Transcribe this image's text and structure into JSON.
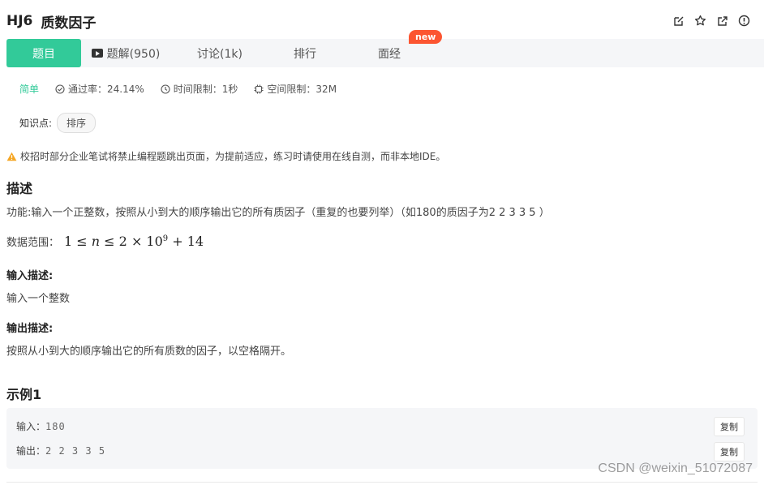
{
  "header": {
    "problem_id": "HJ6",
    "problem_name": "质数因子",
    "actions": [
      "edit-icon",
      "star-icon",
      "external-link-icon",
      "info-icon"
    ]
  },
  "tabs": {
    "items": [
      {
        "label": "题目",
        "active": true
      },
      {
        "label": "题解(950)",
        "icon": "play-icon"
      },
      {
        "label": "讨论(1k)"
      },
      {
        "label": "排行"
      },
      {
        "label": "面经"
      }
    ],
    "new_badge": "new"
  },
  "meta": {
    "difficulty": "简单",
    "pass_rate": "通过率：24.14%",
    "time_limit": "时间限制：1秒",
    "space_limit": "空间限制：32M"
  },
  "knowledge": {
    "label": "知识点:",
    "tags": [
      "排序"
    ]
  },
  "warning": "校招时部分企业笔试将禁止编程题跳出页面，为提前适应，练习时请使用在线自测，而非本地IDE。",
  "description": {
    "heading": "描述",
    "text": "功能:输入一个正整数，按照从小到大的顺序输出它的所有质因子（重复的也要列举）（如180的质因子为2 2 3 3 5 ）",
    "range_label": "数据范围：",
    "range_math": {
      "left": "1 ≤ ",
      "var": "n",
      "mid": " ≤ 2 × 10",
      "exp": "9",
      "right": " + 14"
    }
  },
  "input_desc": {
    "heading": "输入描述:",
    "text": "输入一个整数"
  },
  "output_desc": {
    "heading": "输出描述:",
    "text": "按照从小到大的顺序输出它的所有质数的因子，以空格隔开。"
  },
  "example": {
    "heading": "示例1",
    "input_label": "输入：",
    "input_value": "180",
    "output_label": "输出：",
    "output_value": "2 2 3 3 5",
    "copy_label": "复制"
  },
  "watermark": "CSDN @weixin_51072087",
  "colors": {
    "accent": "#32ca99",
    "badge": "#fc5531",
    "warning": "#f5a623"
  }
}
